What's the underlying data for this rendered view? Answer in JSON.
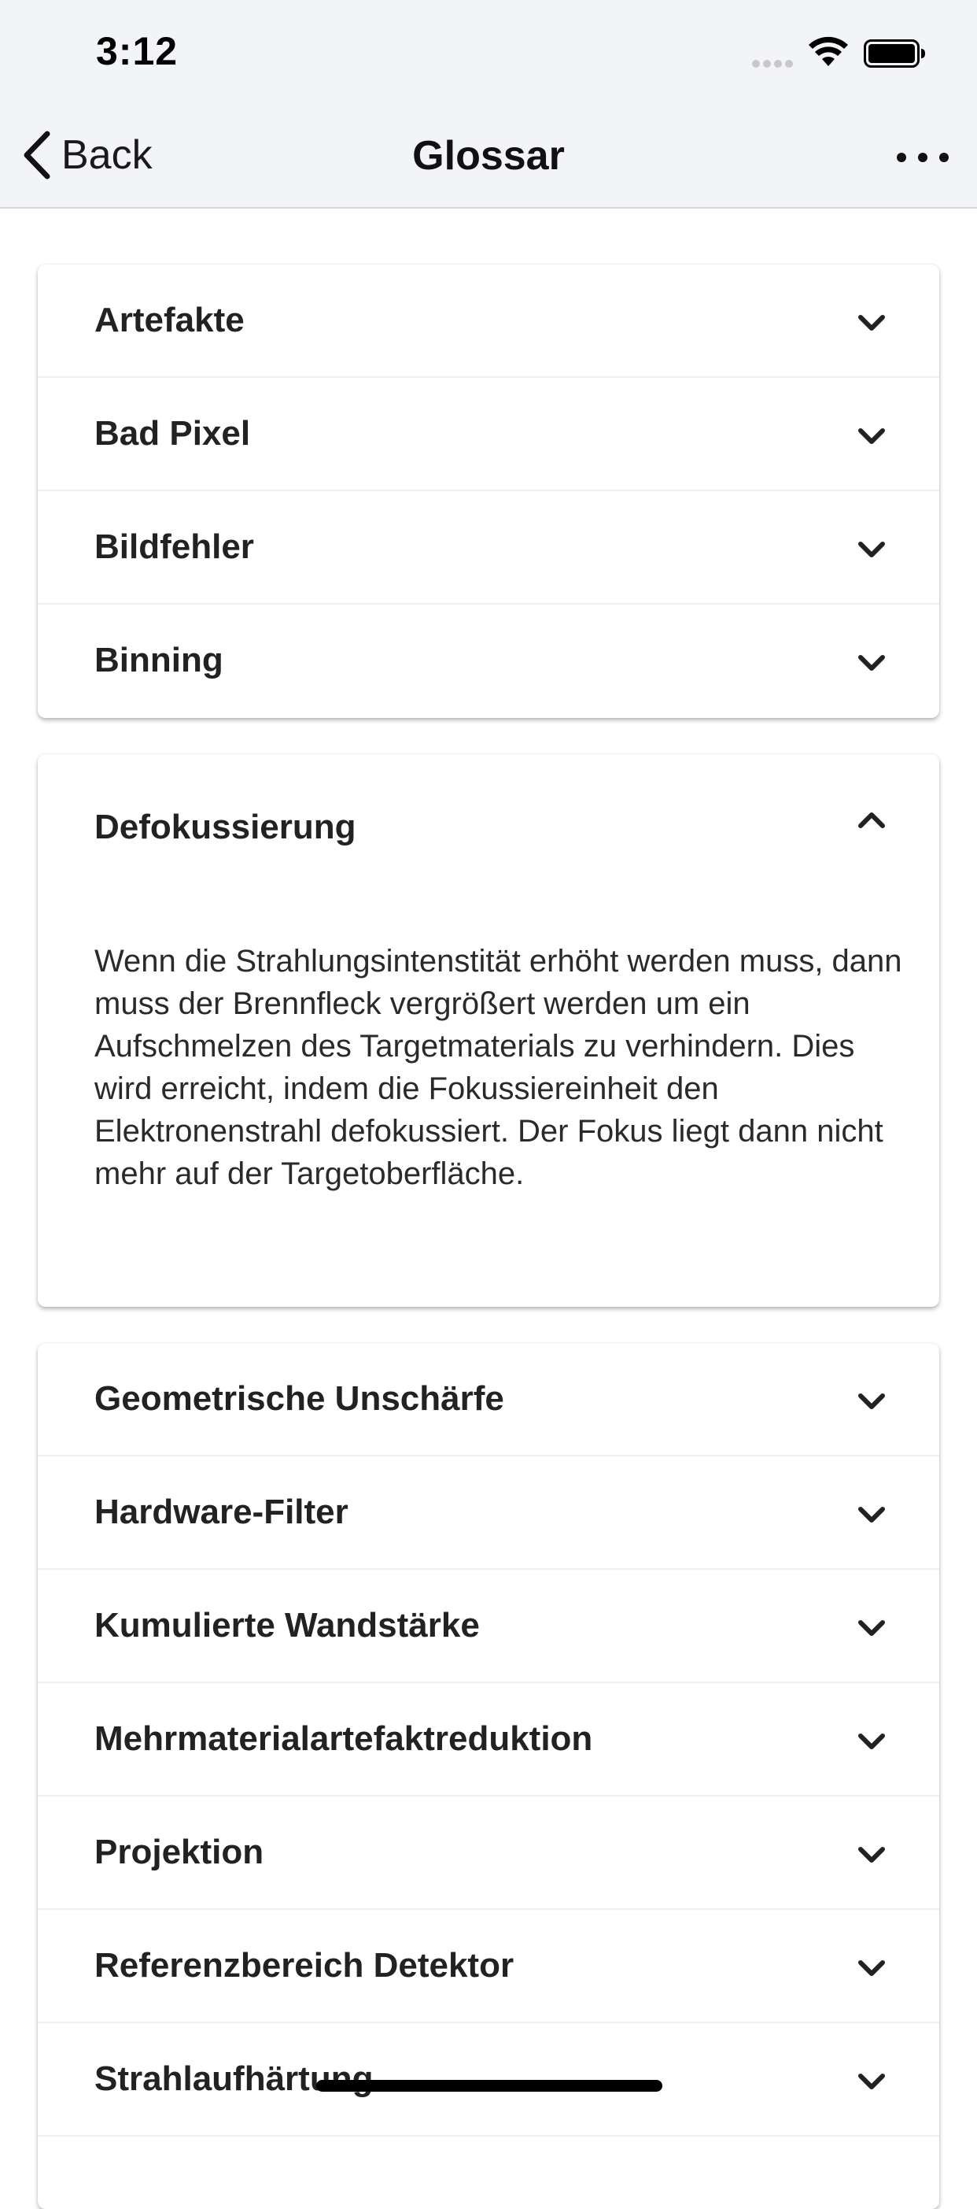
{
  "status_bar": {
    "time": "3:12"
  },
  "nav": {
    "back_label": "Back",
    "title": "Glossar"
  },
  "glossary": {
    "group1": [
      {
        "label": "Artefakte"
      },
      {
        "label": "Bad Pixel"
      },
      {
        "label": "Bildfehler"
      },
      {
        "label": "Binning"
      }
    ],
    "expanded": {
      "label": "Defokussierung",
      "text": "Wenn die Strahlungsintenstität erhöht werden muss, dann muss der Brennfleck vergrößert werden um ein Aufschmelzen des Targetmaterials zu verhindern. Dies wird erreicht, indem die Fokussiereinheit den Elektronenstrahl defokussiert. Der Fokus liegt dann nicht mehr auf der Targetoberfläche."
    },
    "group2": [
      {
        "label": "Geometrische Unschärfe"
      },
      {
        "label": "Hardware-Filter"
      },
      {
        "label": "Kumulierte Wandstärke"
      },
      {
        "label": "Mehrmaterialartefaktreduktion"
      },
      {
        "label": "Projektion"
      },
      {
        "label": "Referenzbereich Detektor"
      },
      {
        "label": "Strahlaufhärtung"
      }
    ]
  },
  "icons": {
    "back": "chevron-left-icon",
    "more": "ellipsis-icon",
    "collapsed": "chevron-down-icon",
    "expanded": "chevron-up-icon"
  }
}
